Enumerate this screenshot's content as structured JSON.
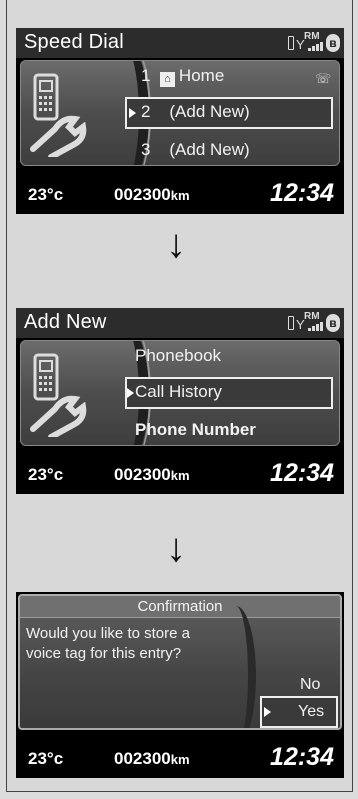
{
  "screen1": {
    "title": "Speed Dial",
    "items": [
      {
        "number": "1",
        "label": "Home"
      },
      {
        "number": "2",
        "label": "(Add New)"
      },
      {
        "number": "3",
        "label": "(Add New)"
      }
    ],
    "selected_index": 1
  },
  "screen2": {
    "title": "Add New",
    "items": [
      "Phonebook",
      "Call History",
      "Phone Number"
    ],
    "selected_index": 1
  },
  "screen3": {
    "dialog_title": "Confirmation",
    "message": "Would you like to store a voice tag for this entry?",
    "options": [
      "No",
      "Yes"
    ],
    "selected_index": 1
  },
  "info_bar": {
    "temperature": "23°c",
    "odometer": "002300",
    "odometer_unit": "km",
    "clock": "12:34"
  },
  "status": {
    "roaming": "RM",
    "icons": [
      "phone-battery-icon",
      "signal-icon",
      "bluetooth-icon"
    ]
  },
  "arrow": "↓",
  "colors": {
    "screen_bg": "#000000",
    "panel": "#5a5a5a",
    "highlight_border": "#eeeeee"
  }
}
